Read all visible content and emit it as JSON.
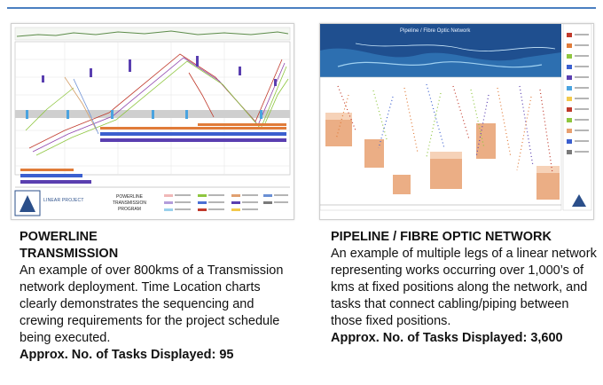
{
  "colors": {
    "rule": "#4a7fc1",
    "gantt_blue": "#3b5fcf",
    "gantt_purple": "#5a3fb0",
    "gantt_green": "#8ec63f",
    "gantt_red": "#c0392b",
    "orange_band": "#e8a070",
    "banner_blue": "#1f4f8f"
  },
  "left": {
    "thumb_logo_text": "LINEAR PROJECT",
    "thumb_caption": "POWERLINE TRANSMISSION PROGRAM",
    "title_line1": "POWERLINE",
    "title_line2": "TRANSMISSION",
    "body": "An example of over 800kms of a Transmission network deployment. Time Location charts clearly demonstrates the sequencing and crewing requirements for the project schedule being executed.",
    "tasks": "Approx. No. of Tasks Displayed: 95"
  },
  "right": {
    "banner_title": "Pipeline / Fibre Optic Network",
    "title": "PIPELINE / FIBRE OPTIC NETWORK",
    "body": "An example of multiple legs of a linear network representing works occurring over 1,000’s of kms at fixed positions along the network, and tasks that connect cabling/piping between those fixed positions.",
    "tasks": "Approx. No. of Tasks Displayed: 3,600"
  }
}
